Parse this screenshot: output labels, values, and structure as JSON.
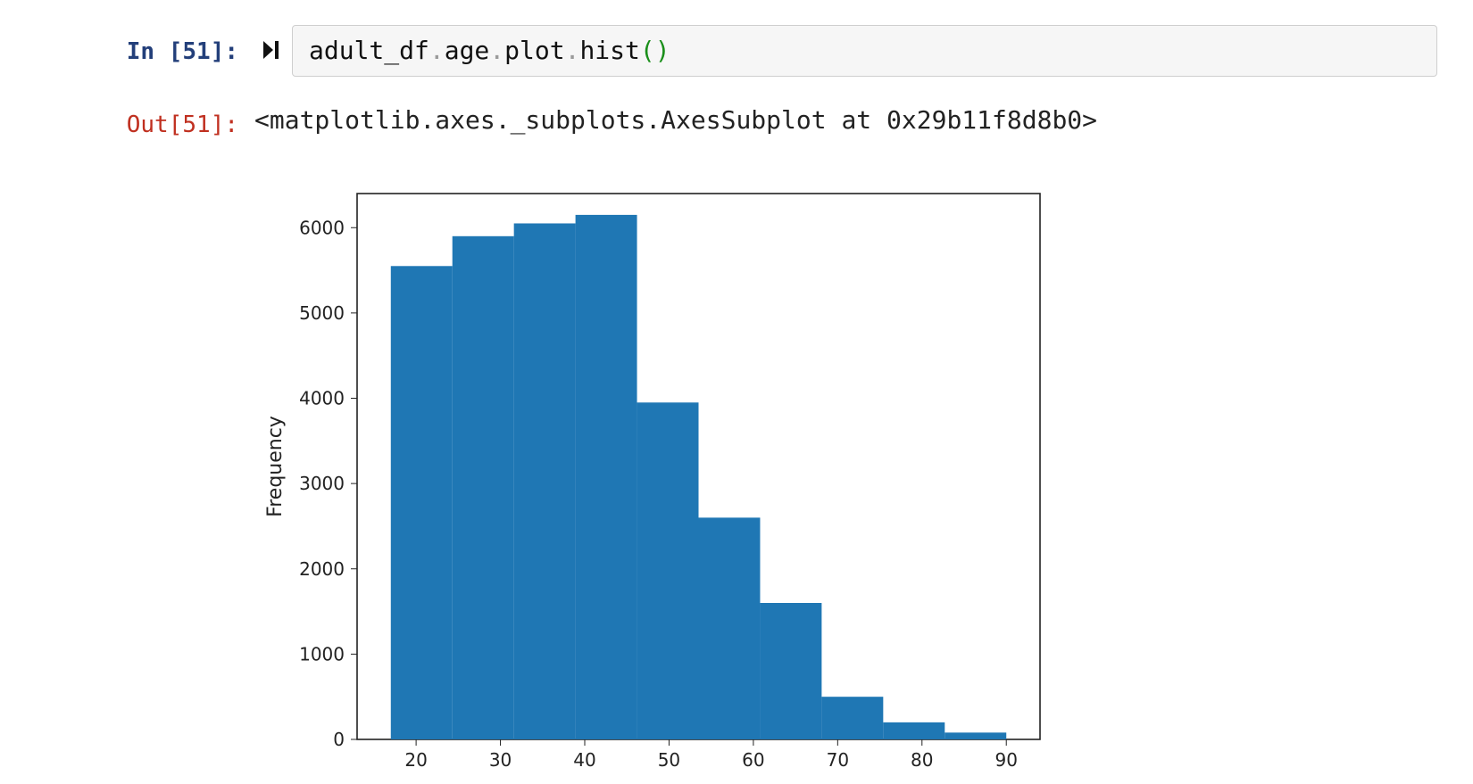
{
  "in_prompt_prefix": "In [",
  "in_prompt_num": "51",
  "in_prompt_suffix": "]:",
  "out_prompt_prefix": "Out[",
  "out_prompt_num": "51",
  "out_prompt_suffix": "]:",
  "code_tokens": {
    "t0": "adult_df",
    "d0": ".",
    "t1": "age",
    "d1": ".",
    "t2": "plot",
    "d2": ".",
    "t3": "hist",
    "po": "(",
    "pc": ")"
  },
  "output_repr": "<matplotlib.axes._subplots.AxesSubplot at 0x29b11f8d8b0>",
  "chart_data": {
    "type": "bar",
    "histogram": true,
    "bin_edges": [
      17,
      24.3,
      31.6,
      38.9,
      46.2,
      53.5,
      60.8,
      68.1,
      75.4,
      82.7,
      90
    ],
    "values": [
      5550,
      5900,
      6050,
      6150,
      3950,
      2600,
      1600,
      500,
      200,
      80
    ],
    "xlabel": "",
    "ylabel": "Frequency",
    "title": "",
    "xlim": [
      13,
      94
    ],
    "ylim": [
      0,
      6400
    ],
    "xticks": [
      20,
      30,
      40,
      50,
      60,
      70,
      80,
      90
    ],
    "yticks": [
      0,
      1000,
      2000,
      3000,
      4000,
      5000,
      6000
    ],
    "bar_color": "#1f77b4"
  }
}
